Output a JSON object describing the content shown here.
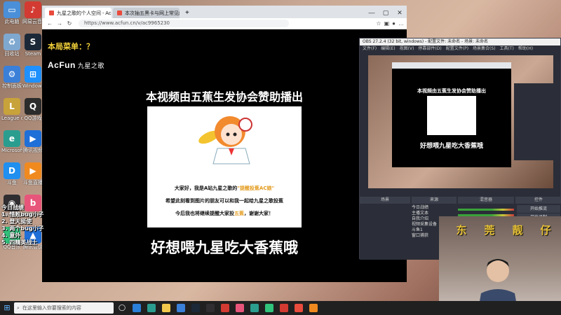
{
  "desktop": {
    "icons": [
      {
        "label": "此电脑",
        "color": "#4a8fd8",
        "glyph": "▭",
        "icon": "computer-icon"
      },
      {
        "label": "网易云音乐",
        "color": "#d33a31",
        "glyph": "♪",
        "icon": "netease-music-icon"
      },
      {
        "label": "回收站",
        "color": "#7fa8d0",
        "glyph": "♻",
        "icon": "recycle-bin-icon"
      },
      {
        "label": "Steam",
        "color": "#1b2838",
        "glyph": "S",
        "icon": "steam-icon"
      },
      {
        "label": "控制面板",
        "color": "#3a7fd8",
        "glyph": "⚙",
        "icon": "control-panel-icon"
      },
      {
        "label": "Windows",
        "color": "#1e90ff",
        "glyph": "⊞",
        "icon": "windows-icon"
      },
      {
        "label": "League of Legends",
        "color": "#c8a23a",
        "glyph": "L",
        "icon": "lol-icon"
      },
      {
        "label": "QQ游戏",
        "color": "#2c2c2c",
        "glyph": "Q",
        "icon": "qq-game-icon"
      },
      {
        "label": "Microsoft Edge",
        "color": "#2a9d8f",
        "glyph": "e",
        "icon": "edge-icon"
      },
      {
        "label": "腾讯视频",
        "color": "#1e6fd8",
        "glyph": "▶",
        "icon": "tencent-video-icon"
      },
      {
        "label": "斗鱼",
        "color": "#1f8ff0",
        "glyph": "D",
        "icon": "douyu-icon"
      },
      {
        "label": "斗鱼直播",
        "color": "#f08a1f",
        "glyph": "▶",
        "icon": "douyu-live-icon"
      },
      {
        "label": "OBS Studio",
        "color": "#302e31",
        "glyph": "◉",
        "icon": "obs-icon"
      },
      {
        "label": "哔哩哔哩",
        "color": "#e8557a",
        "glyph": "b",
        "icon": "bilibili-icon"
      },
      {
        "label": "QQ音乐",
        "color": "#31c27c",
        "glyph": "♫",
        "icon": "qq-music-icon"
      },
      {
        "label": "腾讯会议",
        "color": "#1e6fd8",
        "glyph": "▲",
        "icon": "tencent-meeting-icon"
      }
    ]
  },
  "browser": {
    "tabs": [
      {
        "title": "九星之歌的个人空间 - AcFun弹幕视频网"
      },
      {
        "title": "本次抽五黑卡与网上常见的斗地主"
      }
    ],
    "url": "https://www.acfun.cn/v/ac9965230",
    "page": {
      "menu_title": "本局菜单：？",
      "logo": "AcFun",
      "logo_sub": "九星之歌",
      "sponsor_line": "本视频由五蕉生发协会赞助播出",
      "ad_line1_a": "大家好，我是A站九星之歌的",
      "ad_line1_hl": "\"提醒投蕉AC娘\"",
      "ad_line2": "希望此刻看到图片的朋友可以和我一起给九星之歌投蕉",
      "ad_line3_a": "今后我也将继续提醒大家投",
      "ad_line3_hl": "五蕉",
      "ad_line3_b": "，谢谢大家！",
      "big_line": "好想喂九星吃大香蕉哦"
    }
  },
  "obs": {
    "title": "OBS 27.2.4 (32 bit, windows) - 配置文件: 未命名 - 场景: 未命名",
    "menu": [
      "文件(F)",
      "编辑(E)",
      "视图(V)",
      "停靠部件(D)",
      "配置文件(P)",
      "场景集合(S)",
      "工具(T)",
      "帮助(H)"
    ],
    "preview_title": "本视频由五蕉生发协会赞助播出",
    "preview_big": "好想喂九星吃大香蕉哦",
    "docks": [
      "场景",
      "来源",
      "混音器",
      "转场动画",
      "控件"
    ],
    "sources": [
      "今日战绩",
      "主播文本",
      "自我介绍",
      "视频采集设备",
      "斗鱼1",
      "窗口捕获"
    ],
    "controls": [
      "开始推流",
      "开始录制",
      "启动虚拟摄像机",
      "工作室模式",
      "设置",
      "退出"
    ]
  },
  "webcam": {
    "overlay_chars": [
      "东",
      "莞",
      "靓",
      "仔"
    ]
  },
  "overlay_list": [
    "今日战绩",
    "1. 惜败bug小子",
    "2. 登天挺使",
    "3. 两个bug小子",
    "4. 意外",
    "5. 四精英战士"
  ],
  "taskbar": {
    "search_placeholder": "在这里输入你要搜索的内容"
  }
}
